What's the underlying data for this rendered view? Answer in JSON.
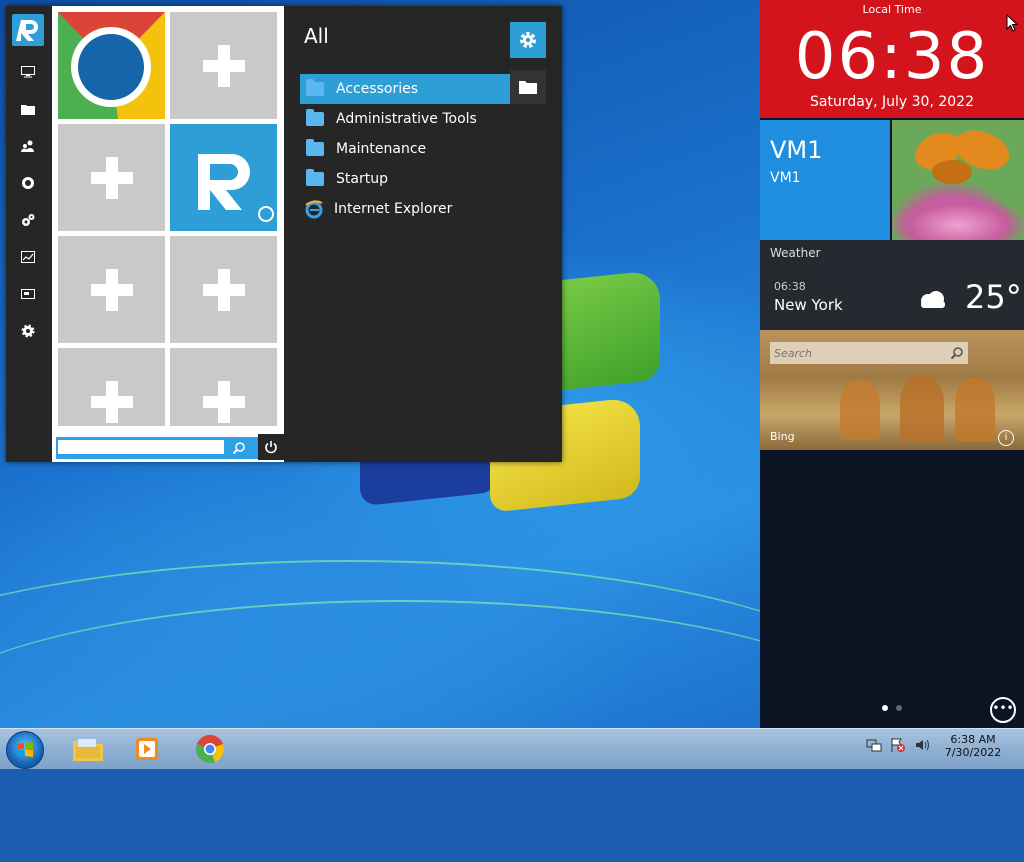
{
  "start_menu": {
    "section_title": "All",
    "programs": [
      {
        "label": "Accessories",
        "icon": "folder-icon",
        "active": true
      },
      {
        "label": "Administrative Tools",
        "icon": "folder-icon"
      },
      {
        "label": "Maintenance",
        "icon": "folder-icon"
      },
      {
        "label": "Startup",
        "icon": "folder-icon"
      },
      {
        "label": "Internet Explorer",
        "icon": "internet-explorer-icon"
      }
    ],
    "search": {
      "value": "",
      "placeholder": ""
    },
    "nav_icons": [
      "monitor-icon",
      "folder-icon",
      "users-icon",
      "network-icon",
      "gears-icon",
      "performance-icon",
      "display-icon",
      "settings-icon"
    ],
    "tiles": [
      {
        "kind": "chrome"
      },
      {
        "kind": "add"
      },
      {
        "kind": "add"
      },
      {
        "kind": "app-logo"
      },
      {
        "kind": "add"
      },
      {
        "kind": "add"
      },
      {
        "kind": "add"
      },
      {
        "kind": "add"
      }
    ]
  },
  "right_panel": {
    "clock": {
      "label": "Local Time",
      "time": "06:38",
      "date": "Saturday, July 30, 2022"
    },
    "vm": {
      "title": "VM1",
      "subtitle": "VM1"
    },
    "weather": {
      "header": "Weather",
      "time": "06:38",
      "city": "New York",
      "temp": "25°"
    },
    "bing": {
      "search_placeholder": "Search",
      "label": "Bing"
    },
    "page_dots": 2,
    "active_page": 1
  },
  "taskbar": {
    "clock_time": "6:38 AM",
    "clock_date": "7/30/2022",
    "apps": [
      "file-explorer-icon",
      "media-player-icon",
      "chrome-icon"
    ]
  },
  "colors": {
    "accent": "#2e9fd6",
    "clock_red": "#d4141c",
    "vm_blue": "#1f8de0",
    "menu_dark": "#262626"
  }
}
